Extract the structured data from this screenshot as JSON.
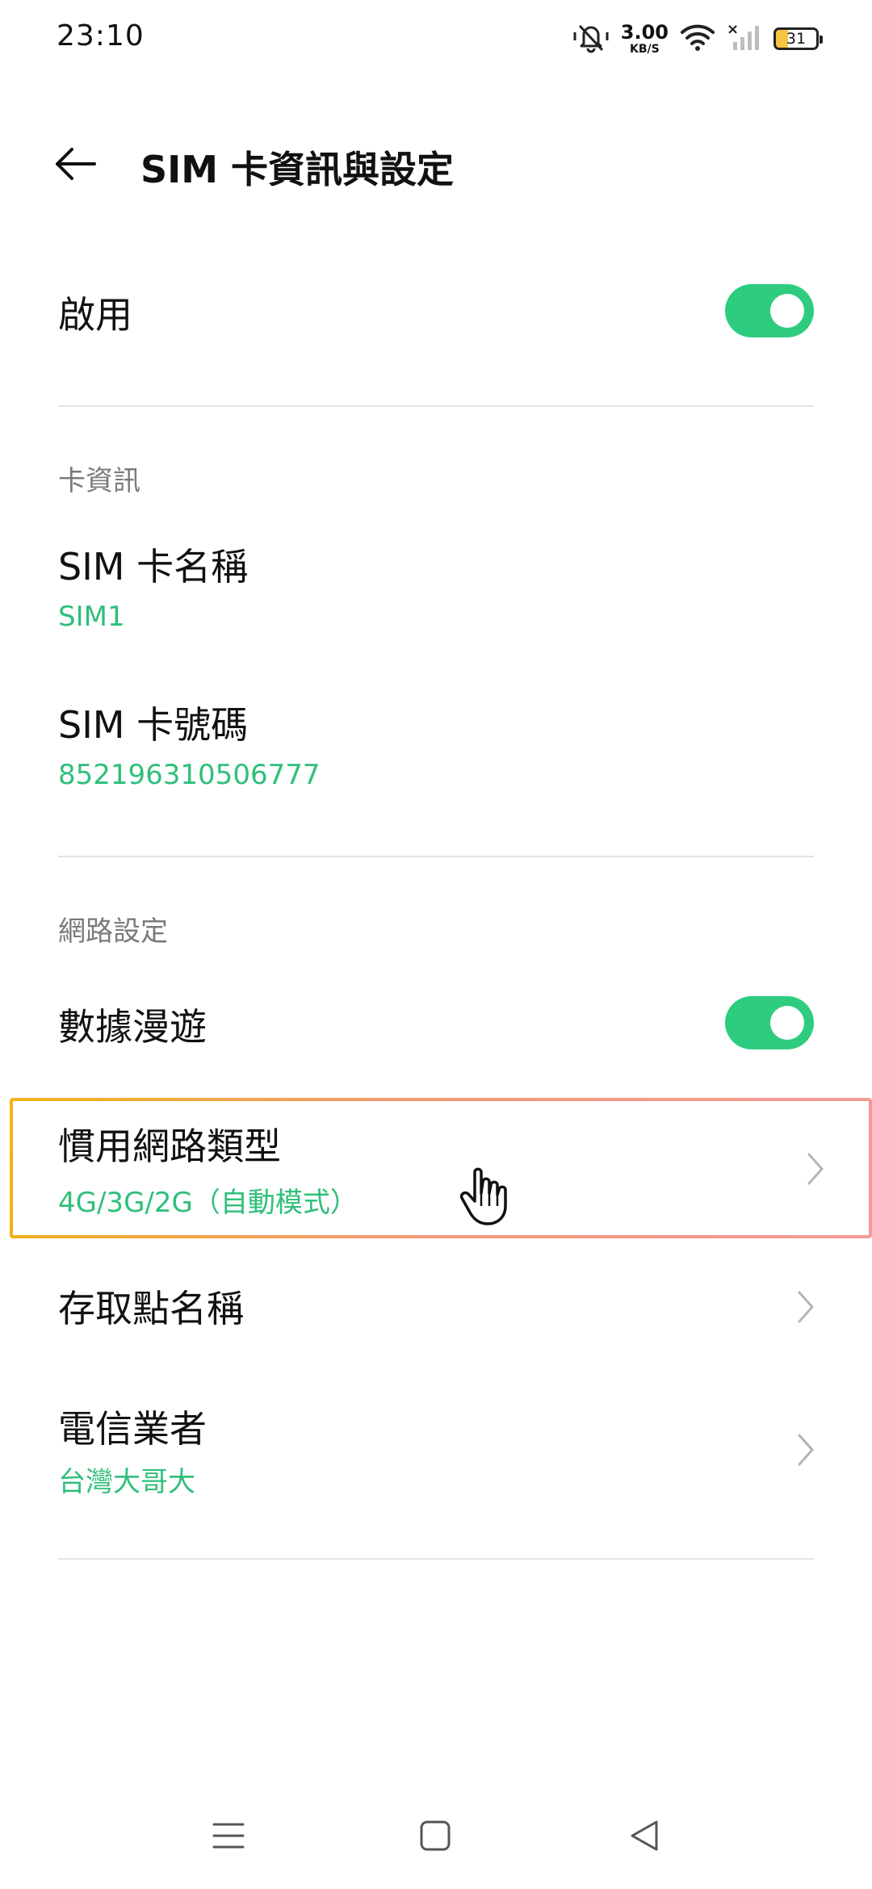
{
  "status_bar": {
    "time": "23:10",
    "net_speed_value": "3.00",
    "net_speed_unit": "KB/S",
    "battery": "31",
    "icons": [
      "mute-icon",
      "wifi-icon",
      "cellular-no-signal-icon",
      "battery-icon"
    ]
  },
  "header": {
    "title": "SIM 卡資訊與設定",
    "back_icon": "back-arrow-icon"
  },
  "enable_row": {
    "title": "啟用",
    "toggle_on": true
  },
  "card_info": {
    "section_label": "卡資訊",
    "name_title": "SIM 卡名稱",
    "name_value": "SIM1",
    "number_title": "SIM 卡號碼",
    "number_value": "852196310506777"
  },
  "network": {
    "section_label": "網路設定",
    "roaming_title": "數據漫遊",
    "roaming_on": true,
    "preferred_title": "慣用網路類型",
    "preferred_value": "4G/3G/2G（自動模式）",
    "apn_title": "存取點名稱",
    "carrier_title": "電信業者",
    "carrier_value": "台灣大哥大"
  },
  "nav": {
    "icons": [
      "menu-icon",
      "home-icon",
      "back-icon"
    ]
  },
  "colors": {
    "accent": "#2ecc7f",
    "accent_text": "#2fbf7a",
    "section_label": "#7a7a7a"
  }
}
